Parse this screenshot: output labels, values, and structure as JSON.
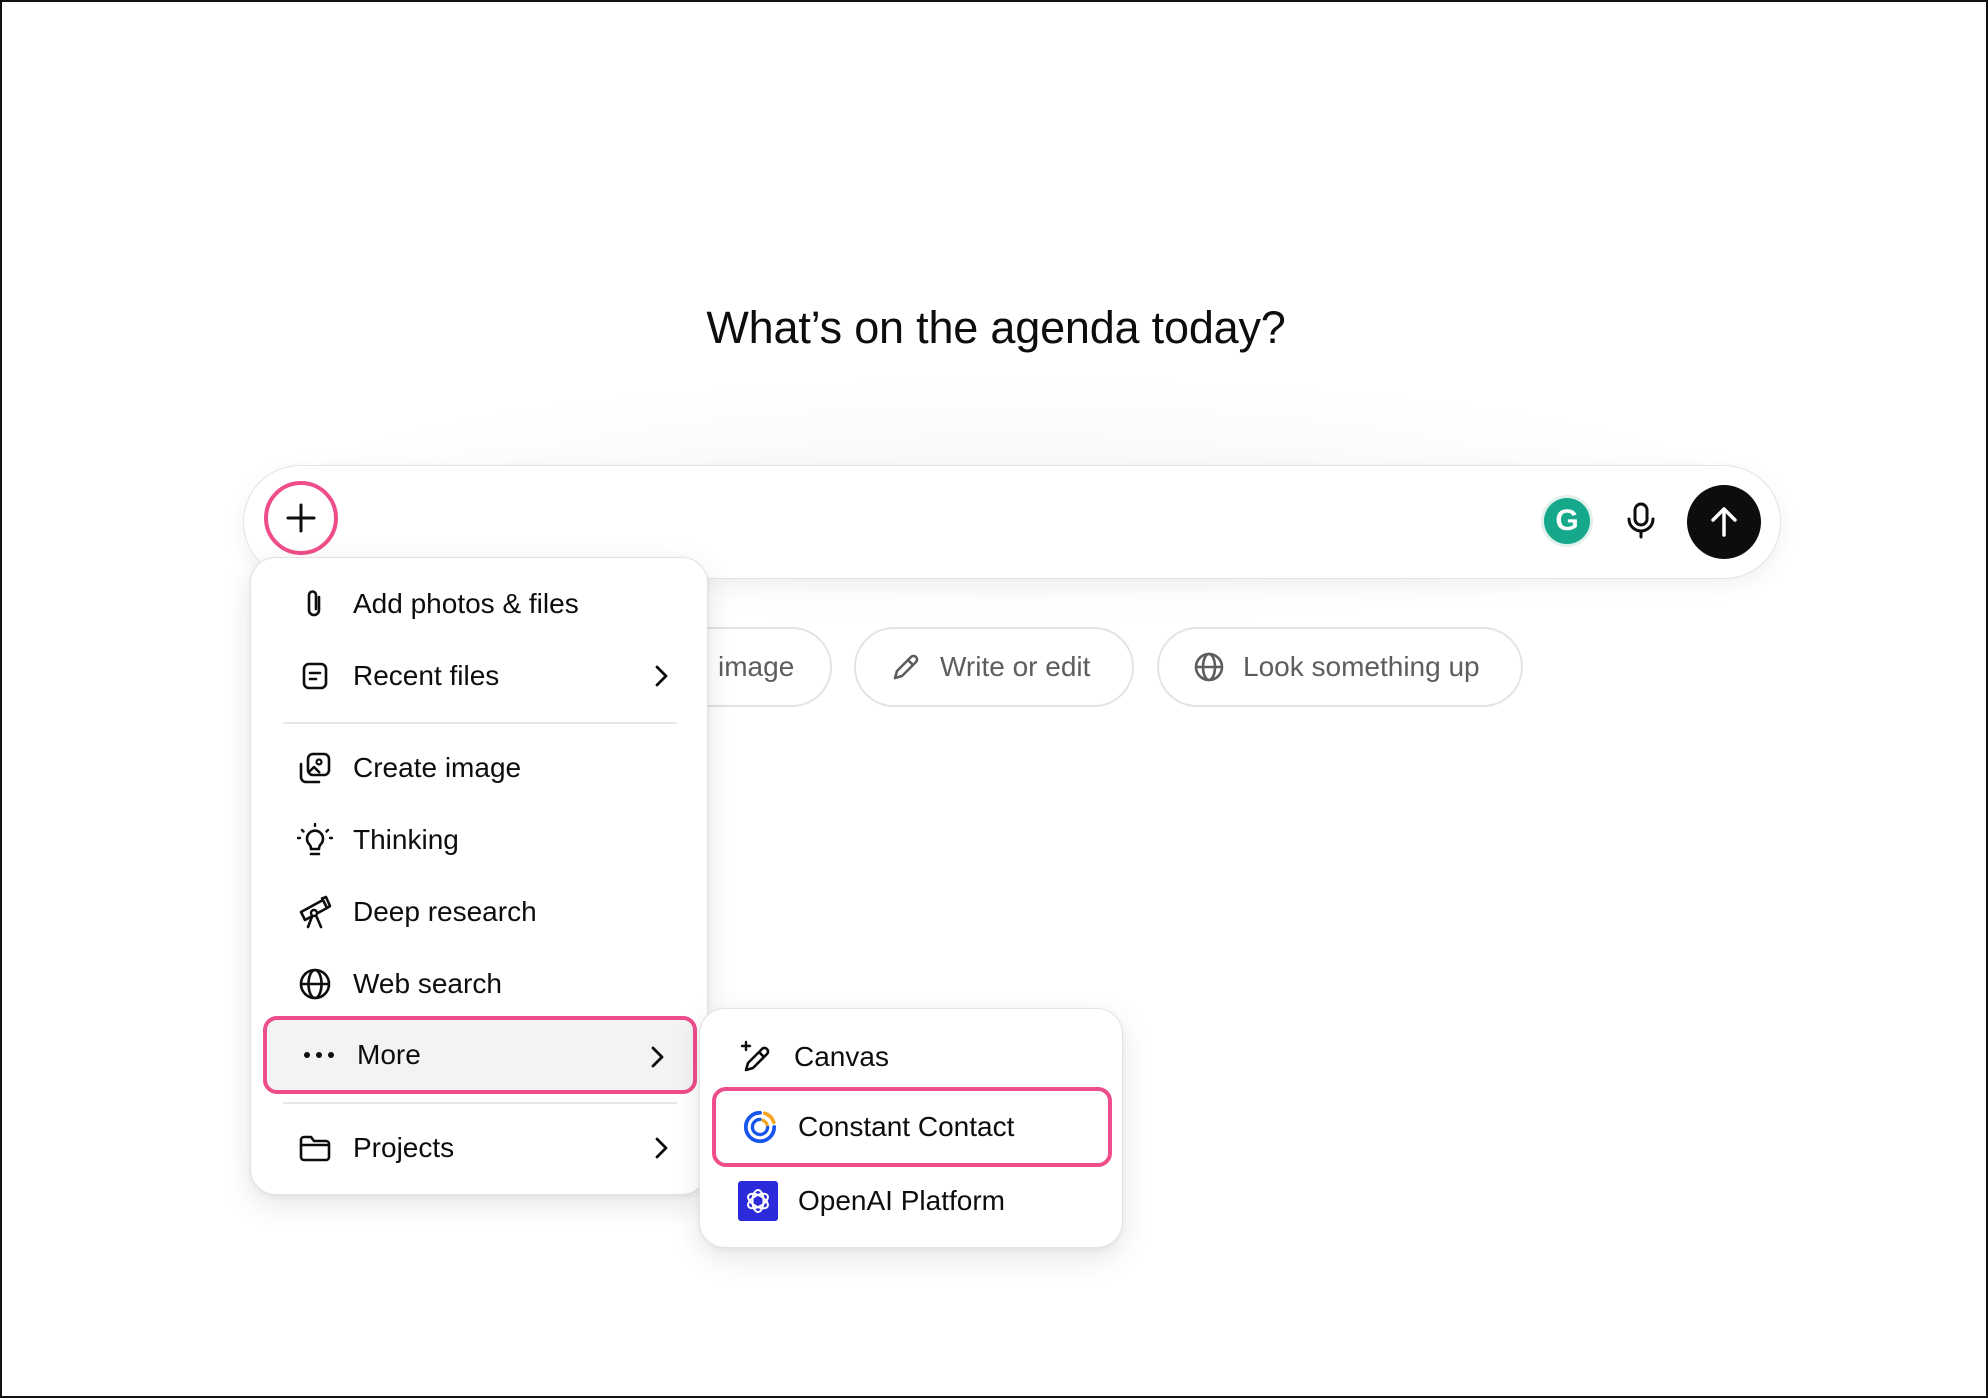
{
  "headline": "What’s on the agenda today?",
  "composer": {
    "plus_icon": "plus-icon",
    "grammarly_letter": "G",
    "mic_icon": "microphone-icon",
    "send_icon": "arrow-up-icon"
  },
  "chips": [
    {
      "label": "image",
      "icon": "image-icon"
    },
    {
      "label": "Write or edit",
      "icon": "pencil-icon"
    },
    {
      "label": "Look something up",
      "icon": "globe-icon"
    }
  ],
  "menu": {
    "items": [
      {
        "label": "Add photos & files",
        "icon": "paperclip-icon"
      },
      {
        "label": "Recent files",
        "icon": "file-icon",
        "has_submenu": true
      },
      {
        "label": "Create image",
        "icon": "create-image-icon"
      },
      {
        "label": "Thinking",
        "icon": "lightbulb-icon"
      },
      {
        "label": "Deep research",
        "icon": "telescope-icon"
      },
      {
        "label": "Web search",
        "icon": "globe-icon"
      },
      {
        "label": "More",
        "icon": "ellipsis-icon",
        "has_submenu": true,
        "highlighted": true
      },
      {
        "label": "Projects",
        "icon": "folder-icon",
        "has_submenu": true
      }
    ]
  },
  "submenu": {
    "items": [
      {
        "label": "Canvas",
        "icon": "canvas-pencil-icon"
      },
      {
        "label": "Constant Contact",
        "icon": "constant-contact-logo-icon",
        "highlighted": true
      },
      {
        "label": "OpenAI Platform",
        "icon": "openai-logo-icon"
      }
    ]
  },
  "colors": {
    "highlight": "#ee4d8a",
    "send_button": "#0d0d0d",
    "grammarly": "#15a88a",
    "openai_logo_bg": "#2b2bdb",
    "constant_contact_blue": "#1856ed",
    "constant_contact_orange": "#f5a623"
  }
}
